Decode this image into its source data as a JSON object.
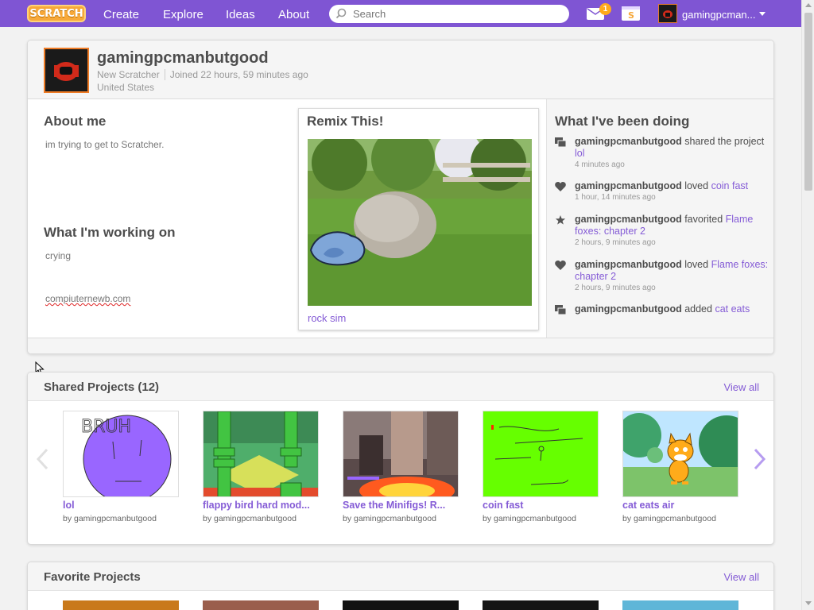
{
  "nav": {
    "logo": "SCRATCH",
    "links": [
      "Create",
      "Explore",
      "Ideas",
      "About"
    ],
    "search_placeholder": "Search",
    "message_count": "1",
    "username": "gamingpcman...",
    "accent": "#7f55d3"
  },
  "profile": {
    "username": "gamingpcmanbutgood",
    "status": "New Scratcher",
    "joined": "Joined 22 hours, 59 minutes ago",
    "country": "United States",
    "about_heading": "About me",
    "about_text": "im trying to get to Scratcher.",
    "working_heading": "What I'm working on",
    "working_text": "crying",
    "working_link": "compiuternewb.com",
    "remix_heading": "Remix This!",
    "remix_project": "rock sim",
    "activity_heading": "What I've been doing"
  },
  "activity": [
    {
      "user": "gamingpcmanbutgood",
      "action": "shared the project",
      "target": "lol",
      "time": "4 minutes ago",
      "icon": "share-icon"
    },
    {
      "user": "gamingpcmanbutgood",
      "action": "loved",
      "target": "coin fast",
      "time": "1 hour, 14 minutes ago",
      "icon": "heart-icon"
    },
    {
      "user": "gamingpcmanbutgood",
      "action": "favorited",
      "target": "Flame foxes: chapter 2",
      "time": "2 hours, 9 minutes ago",
      "icon": "star-icon"
    },
    {
      "user": "gamingpcmanbutgood",
      "action": "loved",
      "target": "Flame foxes: chapter 2",
      "time": "2 hours, 9 minutes ago",
      "icon": "heart-icon"
    },
    {
      "user": "gamingpcmanbutgood",
      "action": "added",
      "target": "cat eats",
      "time": "",
      "icon": "share-icon"
    }
  ],
  "shared": {
    "title": "Shared Projects (12)",
    "view_all": "View all",
    "projects": [
      {
        "title": "lol",
        "by": "by gamingpcmanbutgood",
        "thumb_text": "BRUH"
      },
      {
        "title": "flappy bird hard mod...",
        "by": "by gamingpcmanbutgood"
      },
      {
        "title": "Save the Minifigs! R...",
        "by": "by gamingpcmanbutgood"
      },
      {
        "title": "coin fast",
        "by": "by gamingpcmanbutgood"
      },
      {
        "title": "cat eats air",
        "by": "by gamingpcmanbutgood"
      }
    ]
  },
  "favorites": {
    "title": "Favorite Projects",
    "view_all": "View all"
  }
}
